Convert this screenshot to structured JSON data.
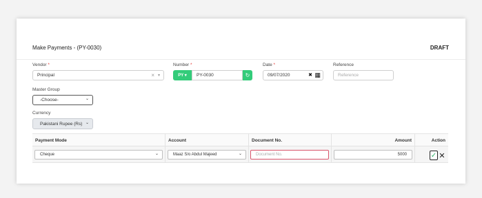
{
  "page": {
    "title": "Make Payments - (PY-0030)",
    "status": "DRAFT"
  },
  "vendor": {
    "label": "Vendor",
    "required": "*",
    "value": "Principal",
    "clear_glyph": "×",
    "arrow_glyph": "▾"
  },
  "number": {
    "label": "Number",
    "required": "*",
    "prefix_button": "PY ▾",
    "value": "PY-0030",
    "refresh_glyph": "↻"
  },
  "date": {
    "label": "Date",
    "required": "*",
    "value": "09/07/2020",
    "clear_glyph": "✖",
    "calendar_glyph": "▦"
  },
  "reference": {
    "label": "Reference",
    "placeholder": "Reference"
  },
  "master_group": {
    "label": "Master Group",
    "value": "-Choose-",
    "arrow_glyph": "⌄"
  },
  "currency": {
    "label": "Currency",
    "value": "Pakistani Rupee (Rs)",
    "arrow_glyph": "⌄"
  },
  "table": {
    "headers": {
      "payment_mode": "Payment Mode",
      "account": "Account",
      "document_no": "Document No.",
      "amount": "Amount",
      "action": "Action"
    },
    "row": {
      "payment_mode": "Cheque",
      "account": "Maaz S/o Abdul Majeed",
      "document_placeholder": "Document No.",
      "amount": "5000",
      "confirm_glyph": "✓",
      "cancel_glyph": "✕"
    }
  },
  "colors": {
    "accent_green": "#33cc7a",
    "required_red": "#e53935",
    "error_border": "#d9536a"
  }
}
